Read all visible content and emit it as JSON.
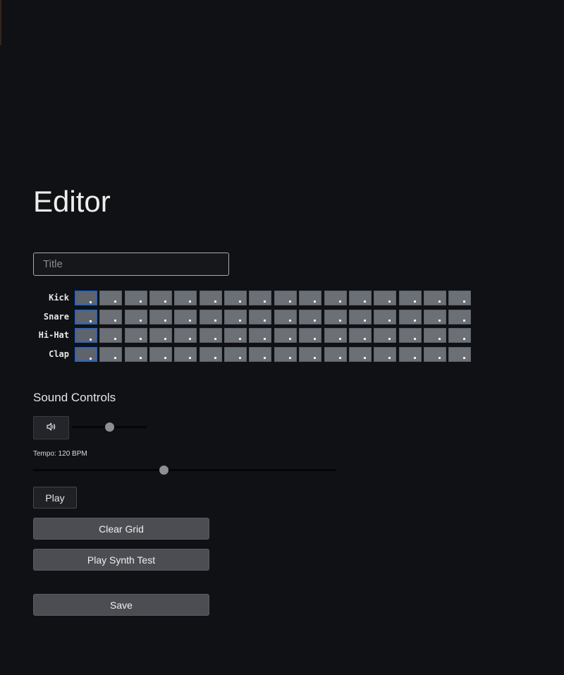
{
  "editor": {
    "title": "Editor",
    "title_input": {
      "value": "",
      "placeholder": "Title"
    }
  },
  "sequencer": {
    "steps_per_track": 16,
    "tracks": [
      {
        "label": "Kick"
      },
      {
        "label": "Snare"
      },
      {
        "label": "Hi-Hat"
      },
      {
        "label": "Clap"
      }
    ]
  },
  "sound_controls": {
    "heading": "Sound Controls",
    "mute_icon": "speaker-volume-icon",
    "volume_level": 0.5,
    "tempo_label": "Tempo: 120 BPM",
    "tempo_bpm": 120,
    "tempo_level": 0.43
  },
  "buttons": {
    "play": "Play",
    "clear_grid": "Clear Grid",
    "play_synth_test": "Play Synth Test",
    "save": "Save"
  },
  "colors": {
    "background": "#101114",
    "step": "#6b6f76",
    "step_selected_border": "#2a64c2",
    "button": "#4b4d53"
  }
}
